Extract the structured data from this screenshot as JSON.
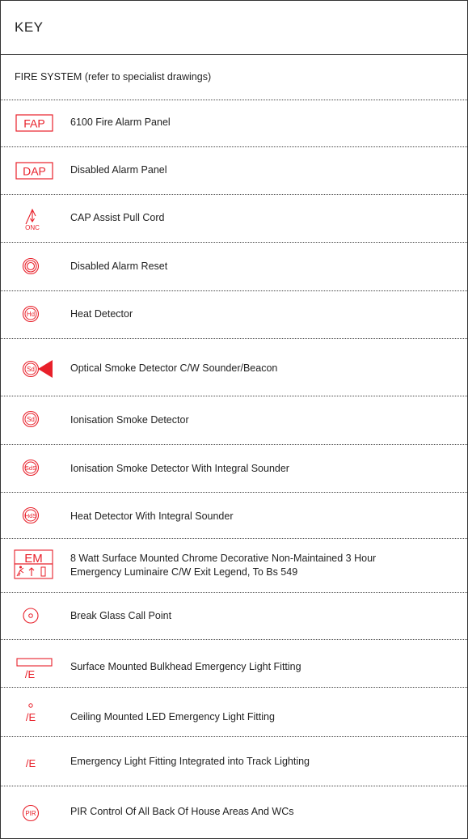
{
  "header": {
    "title": "KEY"
  },
  "section": {
    "title": "FIRE SYSTEM (refer to specialist drawings)"
  },
  "symbol_color": "#e8202a",
  "items": [
    {
      "icon": "fire-alarm-panel-icon",
      "symbol_text": "FAP",
      "label": "6100 Fire Alarm Panel"
    },
    {
      "icon": "disabled-alarm-panel-icon",
      "symbol_text": "DAP",
      "label": "Disabled Alarm Panel"
    },
    {
      "icon": "pull-cord-icon",
      "symbol_text": "ONC",
      "label": "CAP Assist Pull Cord"
    },
    {
      "icon": "alarm-reset-icon",
      "label": "Disabled Alarm Reset"
    },
    {
      "icon": "heat-detector-icon",
      "symbol_text": "Hd",
      "label": "Heat Detector"
    },
    {
      "icon": "smoke-detector-sounder-icon",
      "symbol_text": "Sd",
      "label": "Optical Smoke Detector C/W Sounder/Beacon"
    },
    {
      "icon": "ionisation-smoke-detector-icon",
      "symbol_text": "Sd",
      "label": "Ionisation Smoke Detector"
    },
    {
      "icon": "ionisation-smoke-sounder-icon",
      "symbol_text": "SdS",
      "label": "Ionisation Smoke Detector With Integral Sounder"
    },
    {
      "icon": "heat-detector-sounder-icon",
      "symbol_text": "HdS",
      "label": "Heat Detector With Integral Sounder"
    },
    {
      "icon": "emergency-luminaire-exit-icon",
      "symbol_text": "EM",
      "label": "8 Watt Surface Mounted Chrome Decorative Non-Maintained 3 Hour",
      "label2": "Emergency Luminaire C/W Exit Legend, To Bs 549"
    },
    {
      "icon": "break-glass-icon",
      "label": "Break Glass Call Point"
    },
    {
      "icon": "bulkhead-emergency-light-icon",
      "symbol_text": "/E",
      "label": "Surface Mounted Bulkhead Emergency Light Fitting"
    },
    {
      "icon": "ceiling-led-emergency-light-icon",
      "symbol_text": "/E",
      "label": "Ceiling Mounted LED Emergency Light Fitting"
    },
    {
      "icon": "track-emergency-light-icon",
      "symbol_text": "/E",
      "label": "Emergency Light Fitting Integrated into Track Lighting"
    },
    {
      "icon": "pir-control-icon",
      "symbol_text": "PIR",
      "label": "PIR Control Of All Back Of House Areas And WCs"
    }
  ]
}
